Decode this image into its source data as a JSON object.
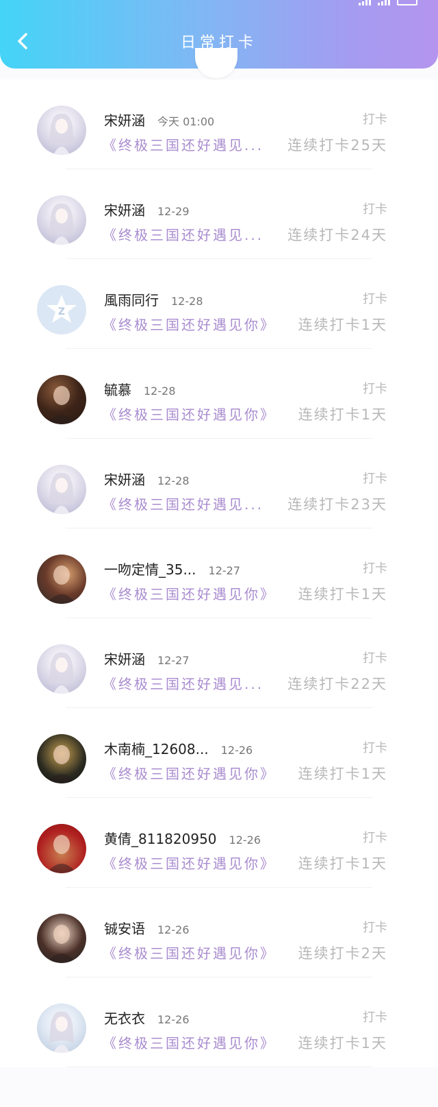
{
  "header": {
    "title": "日常打卡"
  },
  "colors": {
    "header_gradient_start": "#44d4f7",
    "header_gradient_end": "#b494ee",
    "book_text": "#a98ccf",
    "muted_text": "#b8b8b8"
  },
  "icons": {
    "back": "chevron-left-icon"
  },
  "checkin_label": "打卡",
  "entries": [
    {
      "name": "宋妍涵",
      "time": "今天 01:00",
      "book": "《终极三国还好遇见...",
      "streak": "连续打卡25天",
      "avatar": "anime"
    },
    {
      "name": "宋妍涵",
      "time": "12-29",
      "book": "《终极三国还好遇见...",
      "streak": "连续打卡24天",
      "avatar": "anime"
    },
    {
      "name": "風雨同行",
      "time": "12-28",
      "book": "《终极三国还好遇见你》",
      "streak": "连续打卡1天",
      "avatar": "qq"
    },
    {
      "name": "毓慕",
      "time": "12-28",
      "book": "《终极三国还好遇见你》",
      "streak": "连续打卡1天",
      "avatar": "photo1"
    },
    {
      "name": "宋妍涵",
      "time": "12-28",
      "book": "《终极三国还好遇见...",
      "streak": "连续打卡23天",
      "avatar": "anime"
    },
    {
      "name": "一吻定情_35...",
      "time": "12-27",
      "book": "《终极三国还好遇见你》",
      "streak": "连续打卡1天",
      "avatar": "photo2"
    },
    {
      "name": "宋妍涵",
      "time": "12-27",
      "book": "《终极三国还好遇见...",
      "streak": "连续打卡22天",
      "avatar": "anime"
    },
    {
      "name": "木南楠_12608...",
      "time": "12-26",
      "book": "《终极三国还好遇见你》",
      "streak": "连续打卡1天",
      "avatar": "photo3"
    },
    {
      "name": "黄倩_811820950",
      "time": "12-26",
      "book": "《终极三国还好遇见你》",
      "streak": "连续打卡1天",
      "avatar": "photo4"
    },
    {
      "name": "铖安语",
      "time": "12-26",
      "book": "《终极三国还好遇见你》",
      "streak": "连续打卡2天",
      "avatar": "photo5"
    },
    {
      "name": "无衣衣",
      "time": "12-26",
      "book": "《终极三国还好遇见你》",
      "streak": "连续打卡1天",
      "avatar": "anime2"
    }
  ]
}
